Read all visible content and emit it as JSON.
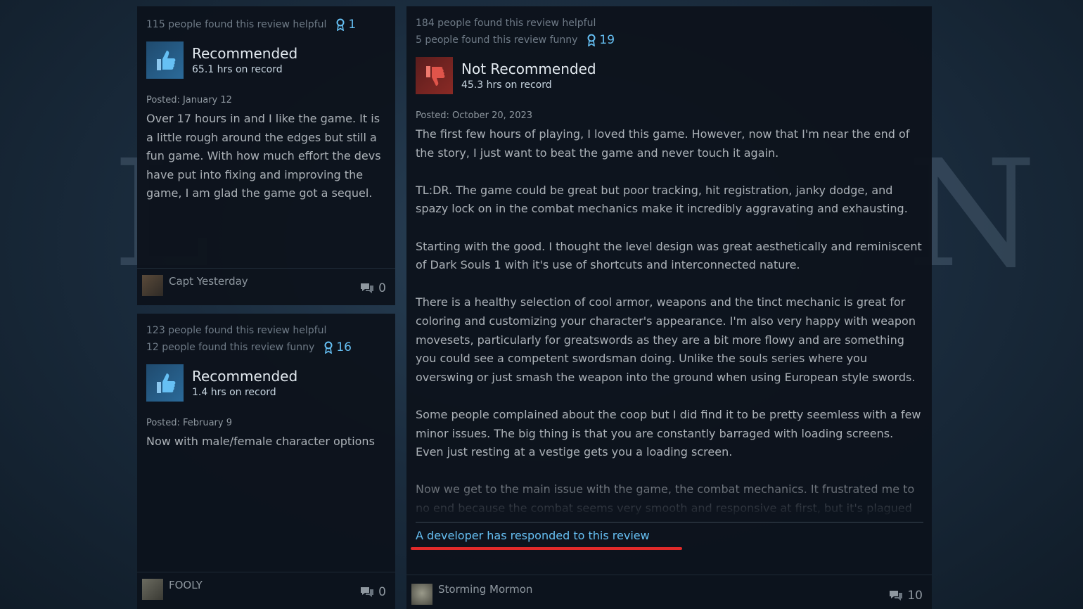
{
  "colors": {
    "accent": "#66c0f4",
    "highlight_underline": "#e02a2a",
    "card_bg": "#0d131c",
    "recommended_thumb": "#2b6a99",
    "not_recommended_thumb": "#8a2a25"
  },
  "reviews": [
    {
      "helpful": "115 people found this review helpful",
      "awards": "1",
      "verdict": "Recommended",
      "verdict_icon": "thumbs-up-icon",
      "hours": "65.1 hrs on record",
      "posted": "Posted: January 12",
      "body": "Over 17 hours in and I like the game. It is a little rough around the edges but still a fun game. With how much effort the devs have put into fixing and improving the game, I am glad the game got a sequel.",
      "user": "Capt Yesterday",
      "comments": "0"
    },
    {
      "helpful": "123 people found this review helpful",
      "funny": "12 people found this review funny",
      "awards": "16",
      "verdict": "Recommended",
      "verdict_icon": "thumbs-up-icon",
      "hours": "1.4 hrs on record",
      "posted": "Posted: February 9",
      "body": "Now with male/female character options",
      "user": "FOOLY",
      "comments": "0"
    },
    {
      "helpful": "184 people found this review helpful",
      "funny": "5 people found this review funny",
      "awards": "19",
      "verdict": "Not Recommended",
      "verdict_icon": "thumbs-down-icon",
      "hours": "45.3 hrs on record",
      "posted": "Posted: October 20, 2023",
      "paragraphs": [
        "The first few hours of playing, I loved this game. However, now that I'm near the end of the story, I just want to beat the game and never touch it again.",
        "TL:DR. The game could be great but poor tracking, hit registration, janky dodge, and spazy lock on in the combat mechanics make it incredibly aggravating and exhausting.",
        "Starting with the good. I thought the level design was great aesthetically and reminiscent of Dark Souls 1 with it's use of shortcuts and interconnected nature.",
        "There is a healthy selection of cool armor, weapons and the tinct mechanic is great for coloring and customizing your character's appearance. I'm also very happy with weapon movesets, particularly for greatswords as they are a bit more flowy and are something you could see a competent swordsman doing. Unlike the souls series where you overswing or just smash the weapon into the ground when using European style swords.",
        "Some people complained about the coop but I did find it to be pretty seemless with a few minor issues. The big thing is that you are constantly barraged with loading screens. Even just resting at a vestige gets you a loading screen.",
        "Now we get to the main issue with the game, the combat mechanics. It frustrated me to no end because the combat seems very smooth and responsive at first, but it's plagued by a fickle lock-on and janky dodge mechanic. The further I progressed into the game the worse"
      ],
      "developer_response": "A developer has responded to this review",
      "user": "Storming Mormon",
      "comments": "10"
    }
  ]
}
